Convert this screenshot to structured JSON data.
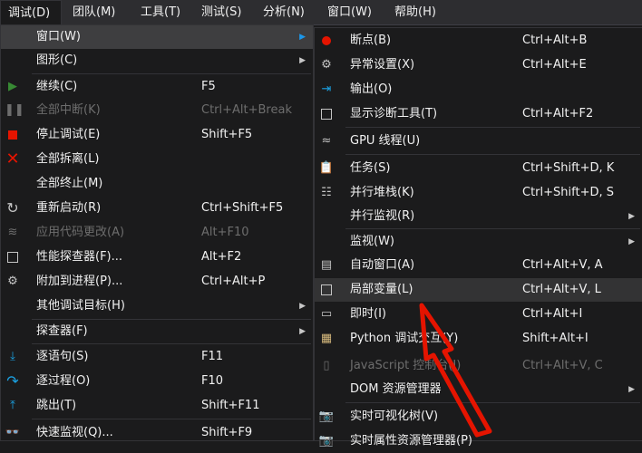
{
  "menubar": [
    {
      "label": "调试(D)",
      "active": true
    },
    {
      "label": "团队(M)"
    },
    {
      "label": "工具(T)"
    },
    {
      "label": "测试(S)"
    },
    {
      "label": "分析(N)"
    },
    {
      "label": "窗口(W)"
    },
    {
      "label": "帮助(H)"
    }
  ],
  "debug_menu": {
    "items": [
      {
        "label": "窗口(W)",
        "shortcut": "",
        "submenu": true
      },
      {
        "label": "图形(C)",
        "shortcut": "",
        "submenu": true
      },
      {
        "label": "继续(C)",
        "shortcut": "F5",
        "icon": "play-icon"
      },
      {
        "label": "全部中断(K)",
        "shortcut": "Ctrl+Alt+Break",
        "icon": "pause-icon",
        "disabled": true
      },
      {
        "label": "停止调试(E)",
        "shortcut": "Shift+F5",
        "icon": "stop-icon"
      },
      {
        "label": "全部拆离(L)",
        "shortcut": "",
        "icon": "detach-icon"
      },
      {
        "label": "全部终止(M)",
        "shortcut": ""
      },
      {
        "label": "重新启动(R)",
        "shortcut": "Ctrl+Shift+F5",
        "icon": "restart-icon"
      },
      {
        "label": "应用代码更改(A)",
        "shortcut": "Alt+F10",
        "icon": "apply-code-icon",
        "disabled": true
      },
      {
        "label": "性能探查器(F)...",
        "shortcut": "Alt+F2",
        "icon": "profiler-icon"
      },
      {
        "label": "附加到进程(P)...",
        "shortcut": "Ctrl+Alt+P",
        "icon": "attach-icon"
      },
      {
        "label": "其他调试目标(H)",
        "shortcut": "",
        "submenu": true
      },
      {
        "label": "探查器(F)",
        "shortcut": "",
        "submenu": true
      },
      {
        "label": "逐语句(S)",
        "shortcut": "F11",
        "icon": "step-into-icon"
      },
      {
        "label": "逐过程(O)",
        "shortcut": "F10",
        "icon": "step-over-icon"
      },
      {
        "label": "跳出(T)",
        "shortcut": "Shift+F11",
        "icon": "step-out-icon"
      },
      {
        "label": "快速监视(Q)...",
        "shortcut": "Shift+F9",
        "icon": "quickwatch-icon"
      }
    ]
  },
  "window_menu": {
    "items": [
      {
        "label": "断点(B)",
        "shortcut": "Ctrl+Alt+B",
        "icon": "breakpoint-icon"
      },
      {
        "label": "异常设置(X)",
        "shortcut": "Ctrl+Alt+E",
        "icon": "exception-settings-icon"
      },
      {
        "label": "输出(O)",
        "shortcut": "",
        "icon": "output-icon"
      },
      {
        "label": "显示诊断工具(T)",
        "shortcut": "Ctrl+Alt+F2",
        "icon": "diagnostic-tools-icon"
      },
      {
        "label": "GPU 线程(U)",
        "shortcut": "",
        "icon": "gpu-threads-icon"
      },
      {
        "label": "任务(S)",
        "shortcut": "Ctrl+Shift+D, K",
        "icon": "tasks-icon"
      },
      {
        "label": "并行堆栈(K)",
        "shortcut": "Ctrl+Shift+D, S",
        "icon": "parallel-stacks-icon"
      },
      {
        "label": "并行监视(R)",
        "shortcut": "",
        "submenu": true
      },
      {
        "label": "监视(W)",
        "shortcut": "",
        "submenu": true
      },
      {
        "label": "自动窗口(A)",
        "shortcut": "Ctrl+Alt+V, A",
        "icon": "autos-icon"
      },
      {
        "label": "局部变量(L)",
        "shortcut": "Ctrl+Alt+V, L",
        "icon": "locals-icon",
        "highlight": true
      },
      {
        "label": "即时(I)",
        "shortcut": "Ctrl+Alt+I",
        "icon": "immediate-icon"
      },
      {
        "label": "Python 调试交互(Y)",
        "shortcut": "Shift+Alt+I",
        "icon": "python-icon"
      },
      {
        "label": "JavaScript 控制台(J)",
        "shortcut": "Ctrl+Alt+V, C",
        "icon": "js-console-icon",
        "disabled": true
      },
      {
        "label": "DOM 资源管理器",
        "shortcut": "",
        "submenu": true
      },
      {
        "label": "实时可视化树(V)",
        "shortcut": "",
        "icon": "live-visual-tree-icon"
      },
      {
        "label": "实时属性资源管理器(P)",
        "shortcut": "",
        "icon": "live-property-icon"
      }
    ]
  },
  "colors": {
    "accent": "#e51400",
    "menu_bg": "#1b1b1c",
    "menubar_bg": "#2d2d30",
    "highlight": "#3e3e40"
  }
}
